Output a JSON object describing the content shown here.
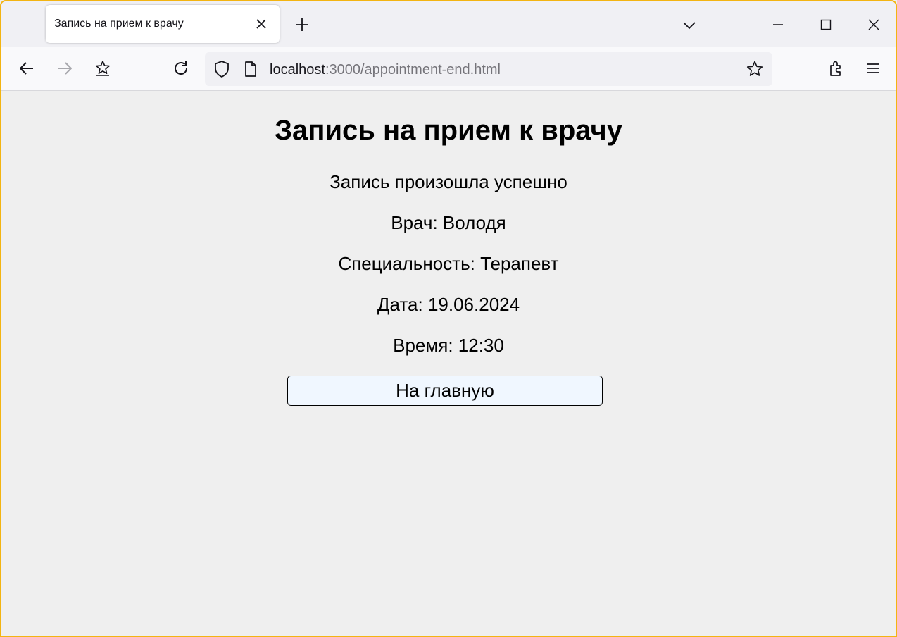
{
  "browser": {
    "tab_title": "Запись на прием к врачу",
    "url_host": "localhost",
    "url_rest": ":3000/appointment-end.html"
  },
  "page": {
    "heading": "Запись на прием к врачу",
    "status": "Запись произошла успешно",
    "doctor": "Врач: Володя",
    "specialty": "Специальность: Терапевт",
    "date": "Дата: 19.06.2024",
    "time": "Время: 12:30",
    "home_button": "На главную"
  },
  "colors": {
    "window_border": "#f3b411",
    "page_background": "#efefef",
    "button_background": "#f0f7ff"
  }
}
